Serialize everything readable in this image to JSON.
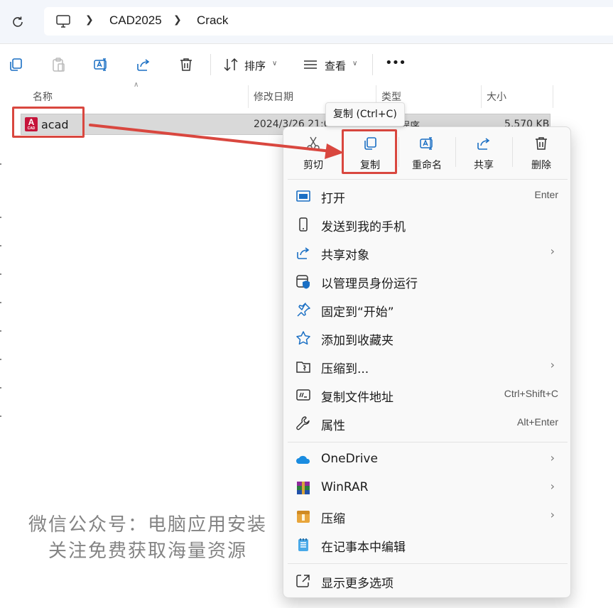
{
  "address_bar": {
    "crumbs": [
      "CAD2025",
      "Crack"
    ]
  },
  "toolbar": {
    "sort_label": "排序",
    "view_label": "查看",
    "more_label": "•••"
  },
  "columns": {
    "name": "名称",
    "date": "修改日期",
    "type": "类型",
    "size": "大小"
  },
  "file": {
    "name": "acad",
    "date": "2024/3/26 21:0",
    "type": "程序",
    "size": "5,570 KB",
    "icon_letter": "A",
    "icon_sub": "CAD"
  },
  "tooltip": "复制 (Ctrl+C)",
  "quick_actions": [
    {
      "label": "剪切",
      "icon": "cut-icon"
    },
    {
      "label": "复制",
      "icon": "copy-icon"
    },
    {
      "label": "重命名",
      "icon": "rename-icon"
    },
    {
      "label": "共享",
      "icon": "share-icon"
    },
    {
      "label": "删除",
      "icon": "delete-icon"
    }
  ],
  "menu_items": [
    {
      "label": "打开",
      "shortcut": "Enter",
      "icon": "open-icon"
    },
    {
      "label": "发送到我的手机",
      "icon": "phone-icon"
    },
    {
      "label": "共享对象",
      "icon": "share-icon"
    },
    {
      "label": "以管理员身份运行",
      "icon": "shield-icon"
    },
    {
      "label": "固定到“开始”",
      "icon": "pin-icon"
    },
    {
      "label": "添加到收藏夹",
      "icon": "star-icon"
    },
    {
      "label": "压缩到...",
      "icon": "zip-folder-icon"
    },
    {
      "label": "复制文件地址",
      "shortcut": "Ctrl+Shift+C",
      "icon": "copy-path-icon"
    },
    {
      "label": "属性",
      "shortcut": "Alt+Enter",
      "icon": "wrench-icon"
    },
    {
      "label": "OneDrive",
      "icon": "onedrive-icon"
    },
    {
      "label": "WinRAR",
      "icon": "winrar-icon"
    },
    {
      "label": "压缩",
      "icon": "archive-icon"
    },
    {
      "label": "在记事本中编辑",
      "icon": "notepad-icon"
    },
    {
      "label": "显示更多选项",
      "icon": "more-options-icon"
    }
  ],
  "watermark": {
    "line1": "微信公众号：电脑应用安装",
    "line2": "关注免费获取海量资源"
  },
  "colors": {
    "annotation_red": "#d9473f",
    "accent_blue": "#1a6fc4"
  }
}
